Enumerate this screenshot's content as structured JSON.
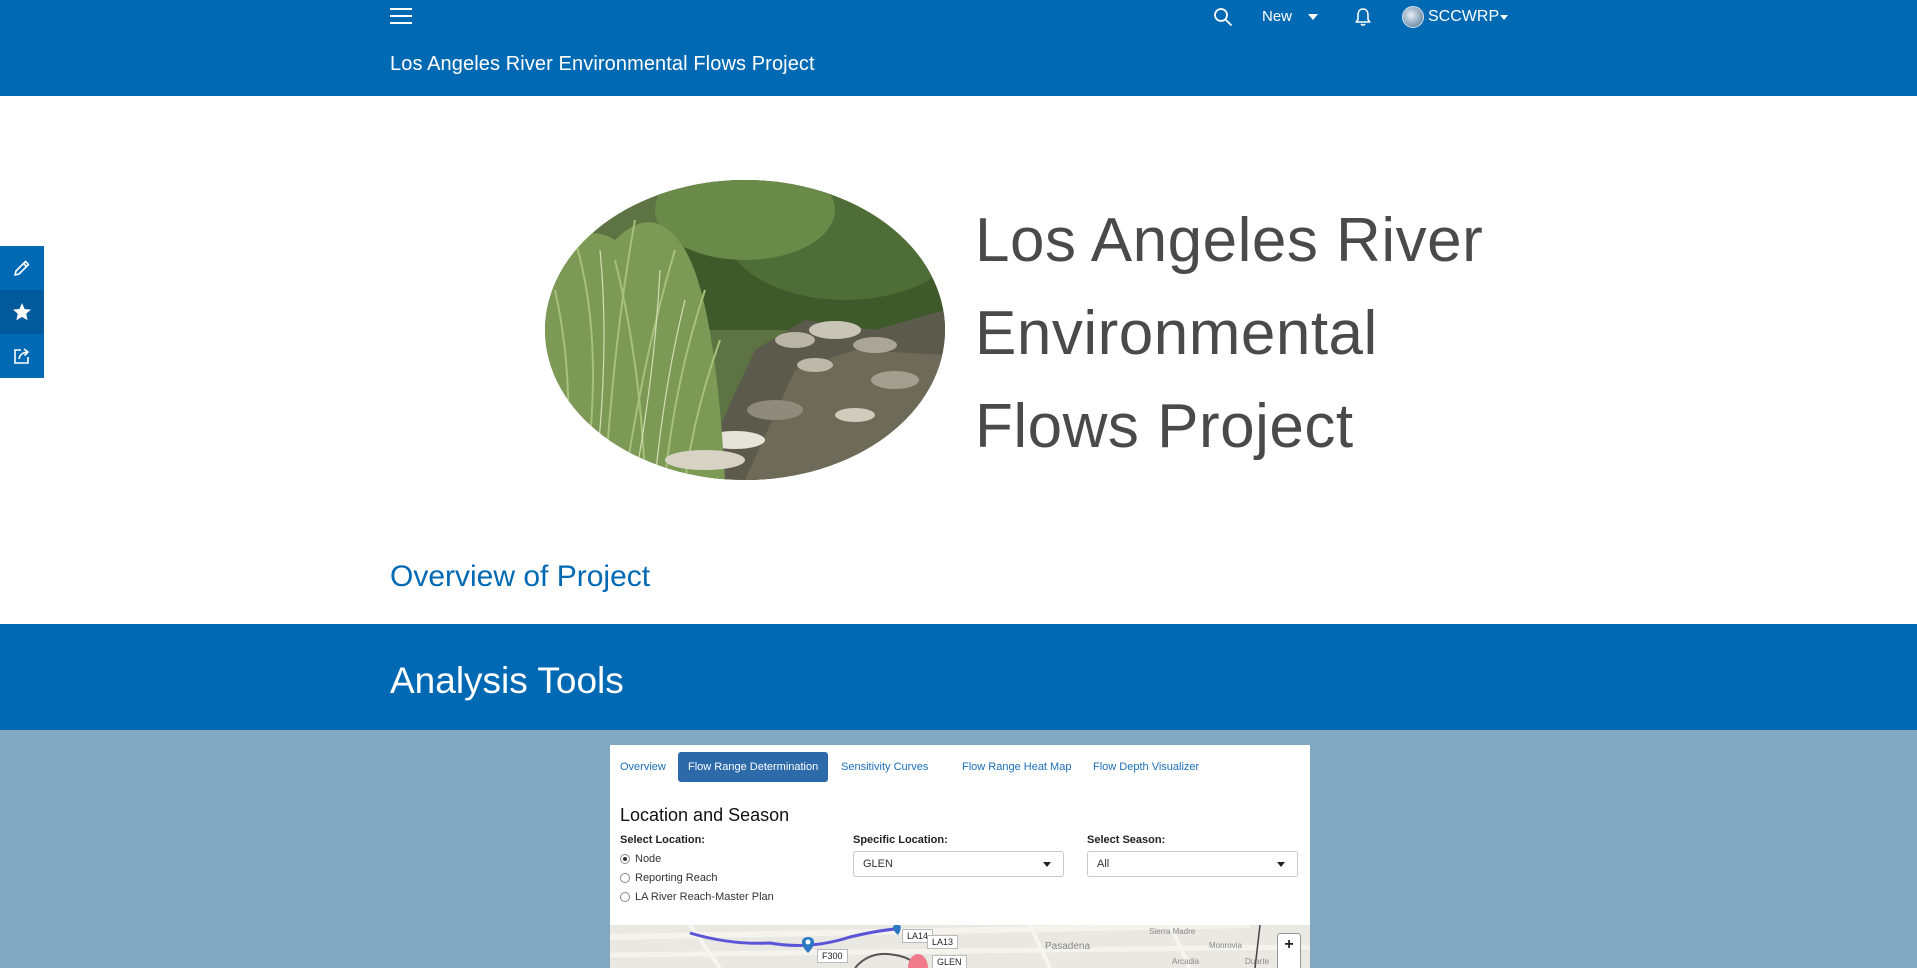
{
  "header": {
    "site_title": "Los Angeles River Environmental Flows Project",
    "new_label": "New",
    "user_label": "SCCWRP",
    "menu_icon": "hamburger-icon",
    "search_icon": "search-icon",
    "bell_icon": "bell-icon"
  },
  "side_toolbar": {
    "items": [
      "pencil-icon",
      "star-icon",
      "share-icon"
    ]
  },
  "hero": {
    "title": "Los Angeles River Environmental Flows Project"
  },
  "links": {
    "overview": "Overview of Project"
  },
  "analysis": {
    "title": "Analysis Tools"
  },
  "app": {
    "tabs": [
      {
        "label": "Overview"
      },
      {
        "label": "Flow Range Determination"
      },
      {
        "label": "Sensitivity Curves"
      },
      {
        "label": "Flow Range Heat Map"
      },
      {
        "label": "Flow Depth Visualizer"
      }
    ],
    "active_tab": "Flow Range Determination",
    "heading": "Location and Season",
    "select_location_label": "Select Location:",
    "location_options": [
      "Node",
      "Reporting Reach",
      "LA River Reach-Master Plan"
    ],
    "selected_location_option": "Node",
    "specific_location_label": "Specific Location:",
    "specific_location_value": "GLEN",
    "season_label": "Select Season:",
    "season_value": "All",
    "map": {
      "node_labels": [
        "F300",
        "LA14",
        "LA13",
        "GLEN"
      ],
      "place_labels": [
        "Pasadena",
        "Sierra Madre",
        "Monrovia",
        "Arcadia",
        "Duarte"
      ],
      "zoom_in": "+"
    }
  },
  "colors": {
    "brand_blue": "#0069b4",
    "lower_background": "#81a8c0",
    "title_gray": "#4a4a4a"
  }
}
